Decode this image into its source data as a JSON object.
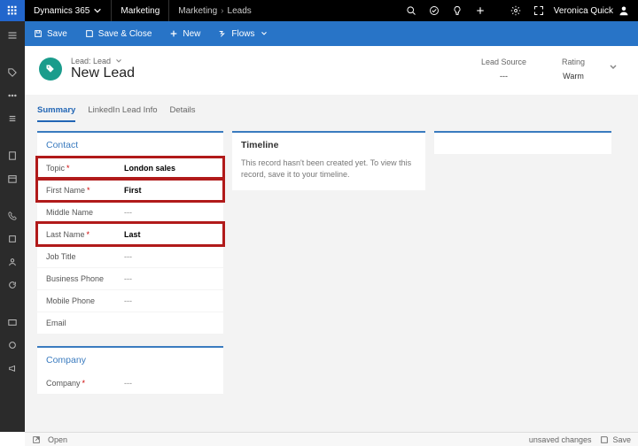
{
  "top": {
    "brand": "Dynamics 365",
    "app": "Marketing",
    "crumb1": "Marketing",
    "crumb2": "Leads",
    "user": "Veronica Quick"
  },
  "cmd": {
    "save": "Save",
    "saveClose": "Save & Close",
    "new": "New",
    "flows": "Flows"
  },
  "header": {
    "entity": "Lead: Lead",
    "name": "New Lead",
    "source_lbl": "Lead Source",
    "source_val": "---",
    "rating_lbl": "Rating",
    "rating_val": "Warm"
  },
  "tabs": {
    "summary": "Summary",
    "linkedin": "LinkedIn Lead Info",
    "details": "Details"
  },
  "contact": {
    "title": "Contact",
    "fields": [
      {
        "label": "Topic",
        "required": true,
        "value": "London sales",
        "hl": true
      },
      {
        "label": "First Name",
        "required": true,
        "value": "First",
        "hl": true
      },
      {
        "label": "Middle Name",
        "required": false,
        "value": "---",
        "hl": false
      },
      {
        "label": "Last Name",
        "required": true,
        "value": "Last",
        "hl": true
      },
      {
        "label": "Job Title",
        "required": false,
        "value": "---",
        "hl": false
      },
      {
        "label": "Business Phone",
        "required": false,
        "value": "---",
        "hl": false
      },
      {
        "label": "Mobile Phone",
        "required": false,
        "value": "---",
        "hl": false
      },
      {
        "label": "Email",
        "required": false,
        "value": "",
        "hl": false
      }
    ]
  },
  "company": {
    "title": "Company",
    "fields": [
      {
        "label": "Company",
        "required": true,
        "value": "---",
        "hl": false
      }
    ]
  },
  "timeline": {
    "title": "Timeline",
    "msg": "This record hasn't been created yet. To view this record, save it to your timeline."
  },
  "status": {
    "open": "Open",
    "unsaved": "unsaved changes",
    "save": "Save"
  }
}
